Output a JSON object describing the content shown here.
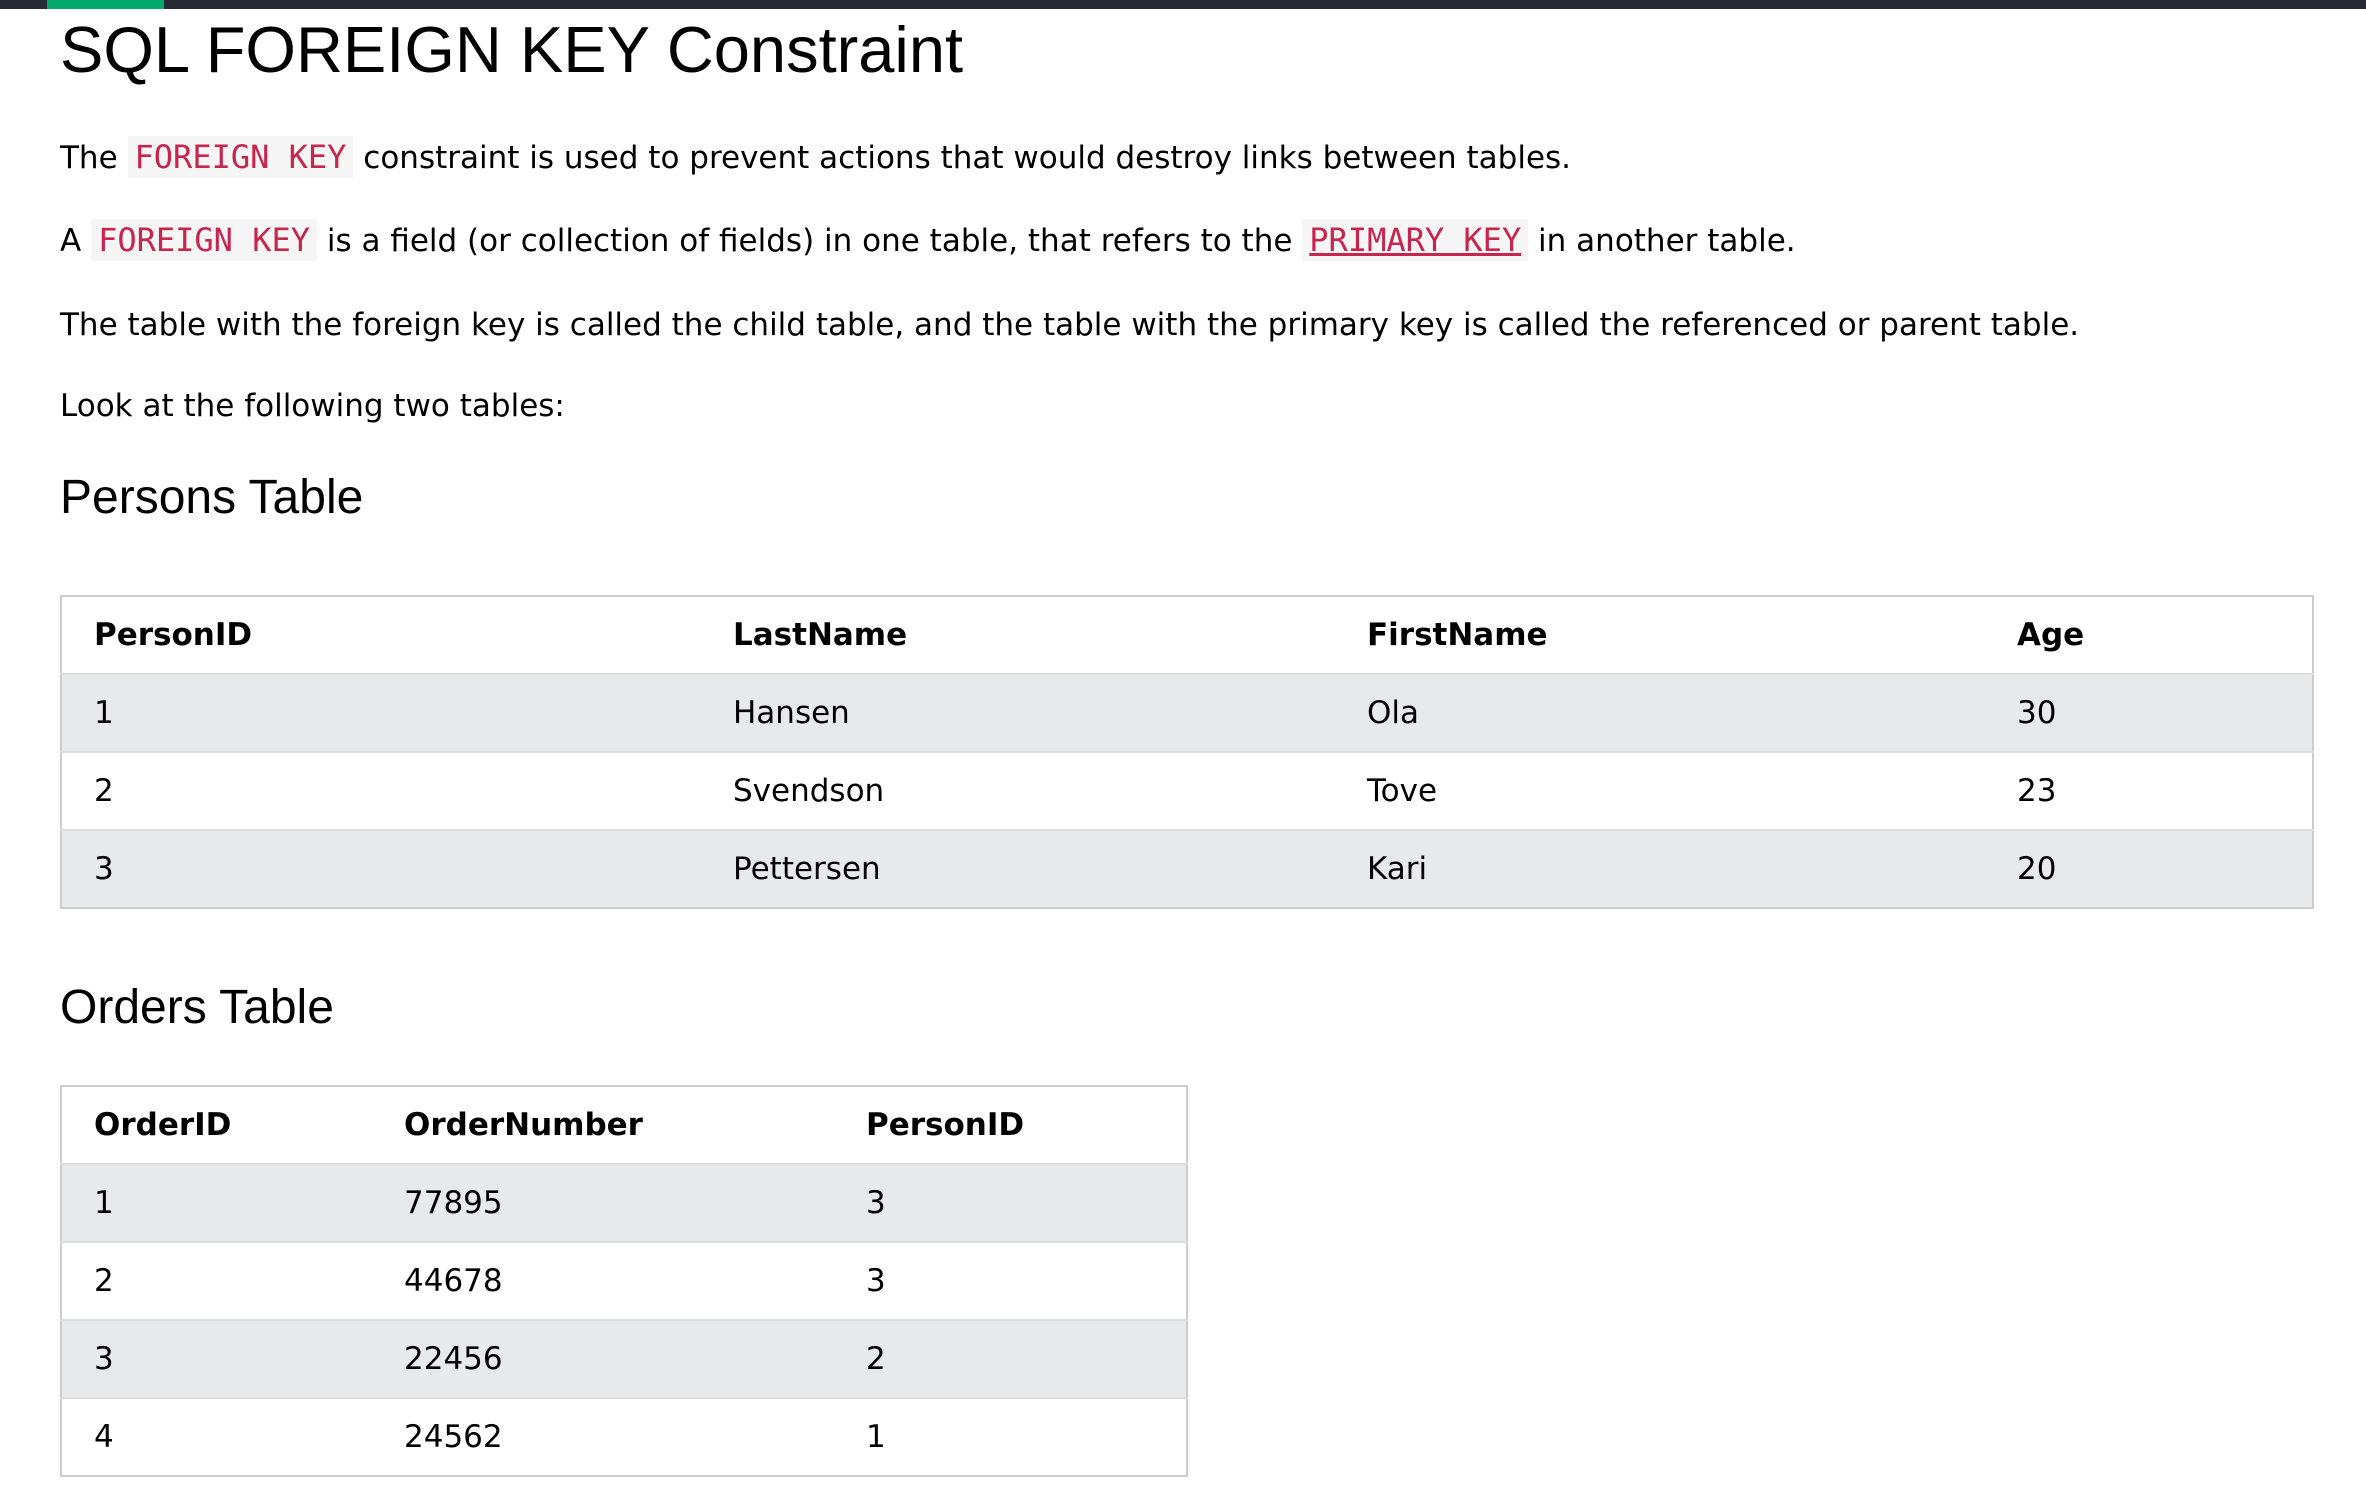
{
  "page": {
    "title": "SQL FOREIGN KEY Constraint",
    "intro": {
      "p1_before": "The ",
      "p1_code": "FOREIGN KEY",
      "p1_after": " constraint is used to prevent actions that would destroy links between tables.",
      "p2_before": "A ",
      "p2_code1": "FOREIGN KEY",
      "p2_mid": " is a field (or collection of fields) in one table, that refers to the ",
      "p2_code2": "PRIMARY KEY",
      "p2_after": " in another table.",
      "p3": "The table with the foreign key is called the child table, and the table with the primary key is called the referenced or parent table.",
      "p4": "Look at the following two tables:"
    }
  },
  "persons": {
    "heading": "Persons Table",
    "columns": [
      "PersonID",
      "LastName",
      "FirstName",
      "Age"
    ],
    "rows": [
      [
        "1",
        "Hansen",
        "Ola",
        "30"
      ],
      [
        "2",
        "Svendson",
        "Tove",
        "23"
      ],
      [
        "3",
        "Pettersen",
        "Kari",
        "20"
      ]
    ]
  },
  "orders": {
    "heading": "Orders Table",
    "columns": [
      "OrderID",
      "OrderNumber",
      "PersonID"
    ],
    "rows": [
      [
        "1",
        "77895",
        "3"
      ],
      [
        "2",
        "44678",
        "3"
      ],
      [
        "3",
        "22456",
        "2"
      ],
      [
        "4",
        "24562",
        "1"
      ]
    ]
  },
  "colors": {
    "code_text": "#c7254e",
    "row_stripe": "#e7e9eb",
    "topbar": "#282a35",
    "topbar_accent": "#04aa6d"
  }
}
